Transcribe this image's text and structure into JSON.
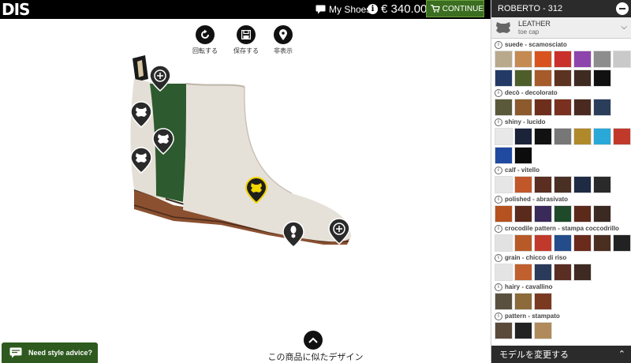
{
  "header": {
    "logo": "DIS",
    "my_shoes_label": "My Shoes",
    "price": "€ 340.00",
    "continue_label": "CONTINUE"
  },
  "toolbar": [
    {
      "label": "回転する",
      "icon": "rotate-icon"
    },
    {
      "label": "保存する",
      "icon": "save-icon"
    },
    {
      "label": "非表示",
      "icon": "location-pin-icon"
    }
  ],
  "similar_designs_label": "この商品に似たデザイン",
  "style_advice_label": "Need style advice?",
  "panel": {
    "title": "ROBERTO - 312",
    "part": {
      "material": "LEATHER",
      "name": "toe cap"
    },
    "footer_label": "モデルを変更する",
    "groups": [
      {
        "title": "suede - scamosciato",
        "swatches": [
          "#b9a98c",
          "#c48a52",
          "#d9531e",
          "#c9302c",
          "#8e44ad",
          "#8d8d8d",
          "#c9c9c9",
          "#233a66",
          "#4e5e2a",
          "#a65b2b",
          "#5c3320",
          "#3f2a22",
          "#111111"
        ]
      },
      {
        "title": "decò - decolorato",
        "swatches": [
          "#5a5a3a",
          "#8c5a2c",
          "#6e2e1c",
          "#7a3020",
          "#4a2a20",
          "#2a3e5c"
        ]
      },
      {
        "title": "shiny - lucido",
        "swatches": [
          "#e8e8e8",
          "#1a2338",
          "#111111",
          "#777777",
          "#b08a2a",
          "#2aa8d8",
          "#c0392b",
          "#1f4aa0",
          "#0c0c0c"
        ]
      },
      {
        "title": "calf - vitello",
        "swatches": [
          "#e6e6e6",
          "#c2572a",
          "#5a2e20",
          "#4a3024",
          "#1f2a44",
          "#2a2a2a"
        ]
      },
      {
        "title": "polished - abrasivato",
        "swatches": [
          "#b5521f",
          "#5a2a1c",
          "#3a2a5a",
          "#1e4a2a",
          "#5c2a1a",
          "#3a2a22"
        ]
      },
      {
        "title": "crocodile pattern - stampa coccodrillo",
        "swatches": [
          "#e2e2e2",
          "#b85a28",
          "#c0392b",
          "#244c8a",
          "#6a2a1c",
          "#4a2e20",
          "#222222"
        ]
      },
      {
        "title": "grain - chicco di riso",
        "swatches": [
          "#e4e4e4",
          "#c0602e",
          "#2a3a5a",
          "#5a2e22",
          "#3e2a22"
        ]
      },
      {
        "title": "hairy - cavallino",
        "swatches": [
          "#5a5040",
          "#8c6a3a",
          "#7a3a22"
        ]
      },
      {
        "title": "pattern - stampato",
        "swatches": [
          "#5a4a3a",
          "#222222",
          "#b08a5a"
        ]
      }
    ]
  }
}
